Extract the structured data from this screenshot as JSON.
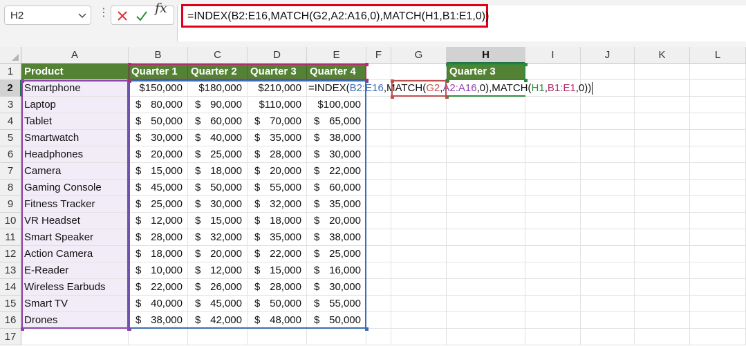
{
  "name_box": {
    "value": "H2"
  },
  "formula_bar": {
    "fx_label": "fx",
    "formula": "=INDEX(B2:E16,MATCH(G2,A2:A16,0),MATCH(H1,B1:E1,0))"
  },
  "columns": [
    "A",
    "B",
    "C",
    "D",
    "E",
    "F",
    "G",
    "H",
    "I",
    "J",
    "K",
    "L"
  ],
  "rows": [
    "1",
    "2",
    "3",
    "4",
    "5",
    "6",
    "7",
    "8",
    "9",
    "10",
    "11",
    "12",
    "13",
    "14",
    "15",
    "16",
    "17"
  ],
  "headers": [
    "Product",
    "Quarter 1",
    "Quarter 2",
    "Quarter 3",
    "Quarter 4"
  ],
  "lookup": {
    "h1": "Quarter 3"
  },
  "editing_formula": {
    "p1": "=INDEX(",
    "p2": "B2:E16",
    "p3": ",MATCH(",
    "p4": "G2",
    "p5": ",",
    "p6": "A2:A16",
    "p7": ",0),MATCH(",
    "p8": "H1",
    "p9": ",",
    "p10": "B1:E1",
    "p11": ",0))"
  },
  "table": [
    {
      "product": "Smartphone",
      "q1": "$150,000",
      "q2": "$180,000",
      "q3": "$210,000",
      "q4": ""
    },
    {
      "product": "Laptop",
      "q1": "80,000",
      "q2": "90,000",
      "q3": "$110,000",
      "q4": "$100,000"
    },
    {
      "product": "Tablet",
      "q1": "50,000",
      "q2": "60,000",
      "q3": "70,000",
      "q4": "65,000"
    },
    {
      "product": "Smartwatch",
      "q1": "30,000",
      "q2": "40,000",
      "q3": "35,000",
      "q4": "38,000"
    },
    {
      "product": "Headphones",
      "q1": "20,000",
      "q2": "25,000",
      "q3": "28,000",
      "q4": "30,000"
    },
    {
      "product": "Camera",
      "q1": "15,000",
      "q2": "18,000",
      "q3": "20,000",
      "q4": "22,000"
    },
    {
      "product": "Gaming Console",
      "q1": "45,000",
      "q2": "50,000",
      "q3": "55,000",
      "q4": "60,000"
    },
    {
      "product": "Fitness Tracker",
      "q1": "25,000",
      "q2": "30,000",
      "q3": "32,000",
      "q4": "35,000"
    },
    {
      "product": "VR Headset",
      "q1": "12,000",
      "q2": "15,000",
      "q3": "18,000",
      "q4": "20,000"
    },
    {
      "product": "Smart Speaker",
      "q1": "28,000",
      "q2": "32,000",
      "q3": "35,000",
      "q4": "38,000"
    },
    {
      "product": "Action Camera",
      "q1": "18,000",
      "q2": "20,000",
      "q3": "22,000",
      "q4": "25,000"
    },
    {
      "product": "E-Reader",
      "q1": "10,000",
      "q2": "12,000",
      "q3": "15,000",
      "q4": "16,000"
    },
    {
      "product": "Wireless Earbuds",
      "q1": "22,000",
      "q2": "26,000",
      "q3": "28,000",
      "q4": "30,000"
    },
    {
      "product": "Smart TV",
      "q1": "40,000",
      "q2": "45,000",
      "q3": "50,000",
      "q4": "55,000"
    },
    {
      "product": "Drones",
      "q1": "38,000",
      "q2": "42,000",
      "q3": "48,000",
      "q4": "50,000"
    }
  ],
  "currency_symbol": "$",
  "colors": {
    "header_bg": "#548235",
    "product_bg": "#f1ecf8",
    "formula_border": "#e0001a",
    "selection": "#217346"
  }
}
